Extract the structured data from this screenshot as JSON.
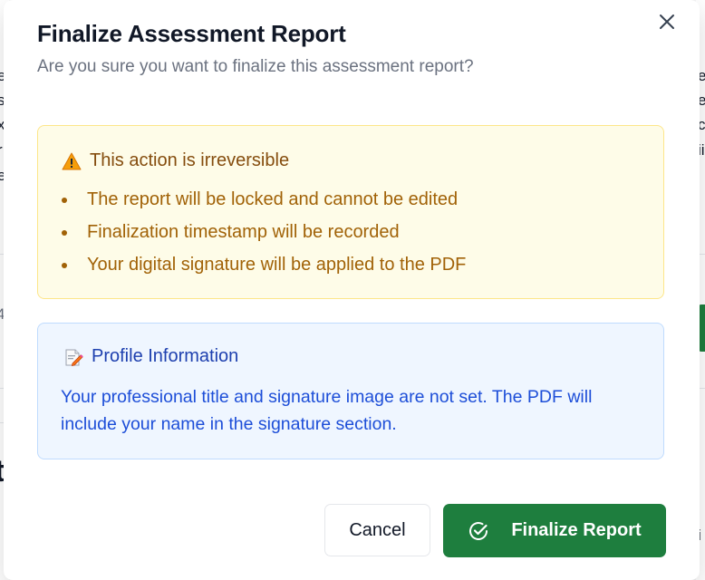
{
  "background": {
    "left_fragments": [
      "e",
      "s",
      "x",
      "r",
      "e",
      "4",
      "t",
      "i"
    ],
    "right_fragments": [
      "e",
      "e",
      "ci",
      "ii",
      "i"
    ]
  },
  "modal": {
    "title": "Finalize Assessment Report",
    "subtitle": "Are you sure you want to finalize this assessment report?",
    "close_icon": "close-icon"
  },
  "warning": {
    "icon": "warning-triangle-icon",
    "heading": "This action is irreversible",
    "items": [
      "The report will be locked and cannot be edited",
      "Finalization timestamp will be recorded",
      "Your digital signature will be applied to the PDF"
    ],
    "colors": {
      "bg": "#fefce8",
      "border": "#fde68a",
      "text": "#a16207"
    }
  },
  "profile_info": {
    "icon": "memo-icon",
    "heading": "Profile Information",
    "text": "Your professional title and signature image are not set. The PDF will include your name in the signature section.",
    "colors": {
      "bg": "#eff6ff",
      "border": "#bfdbfe",
      "text": "#1d4ed8"
    }
  },
  "actions": {
    "cancel_label": "Cancel",
    "finalize_label": "Finalize Report",
    "finalize_icon": "check-circle-icon",
    "finalize_color": "#1e7e3e"
  }
}
